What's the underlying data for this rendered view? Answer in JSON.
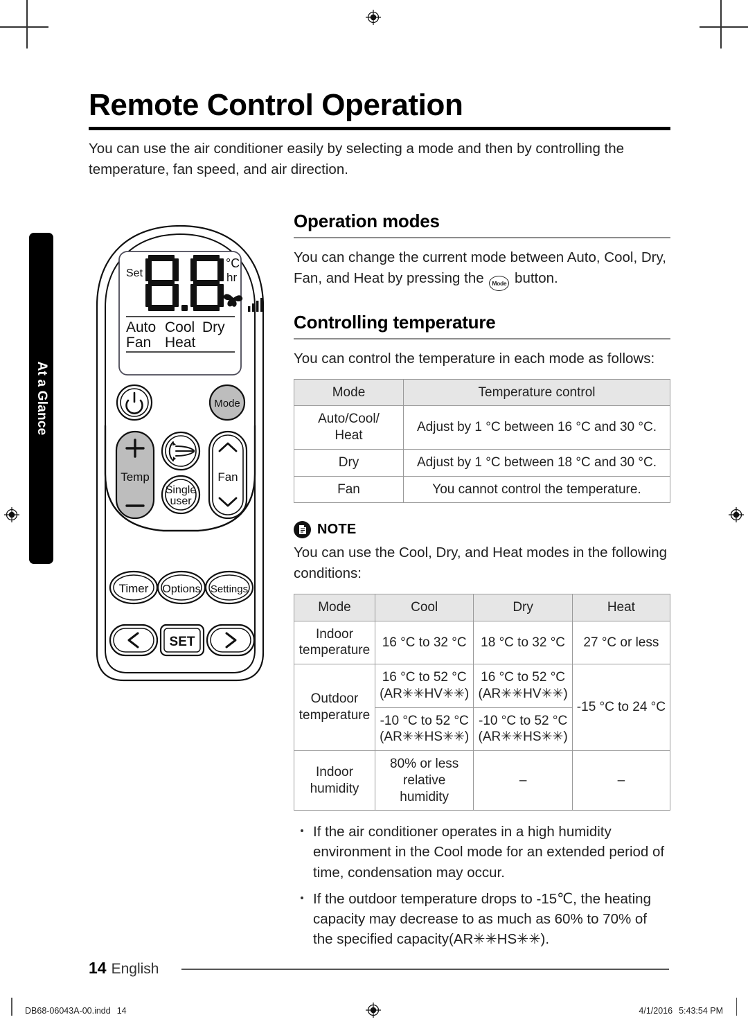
{
  "page": {
    "title": "Remote Control Operation",
    "intro": "You can use the air conditioner easily by selecting a mode and then by controlling the temperature, fan speed, and air direction.",
    "side_tab": "At a Glance",
    "page_number": "14",
    "language": "English"
  },
  "sections": {
    "operation_modes": {
      "heading": "Operation modes",
      "body_before": "You can change the current mode between Auto, Cool, Dry, Fan, and Heat by pressing the",
      "chip_label": "Mode",
      "body_after": "button."
    },
    "controlling_temperature": {
      "heading": "Controlling temperature",
      "body": "You can control the temperature in each mode as follows:"
    }
  },
  "table_temp_control": {
    "headers": [
      "Mode",
      "Temperature control"
    ],
    "rows": [
      {
        "mode": "Auto/Cool/\nHeat",
        "control": "Adjust by 1 °C between 16 °C and 30 °C."
      },
      {
        "mode": "Dry",
        "control": "Adjust by 1 °C between 18 °C and 30 °C."
      },
      {
        "mode": "Fan",
        "control": "You cannot control the temperature."
      }
    ]
  },
  "note": {
    "label": "NOTE",
    "icon": "document-icon",
    "body": "You can use the Cool, Dry, and Heat modes in the following conditions:"
  },
  "table_conditions": {
    "headers": [
      "Mode",
      "Cool",
      "Dry",
      "Heat"
    ],
    "indoor_temperature": {
      "label": "Indoor\ntemperature",
      "cool": "16 °C to 32 °C",
      "dry": "18 °C to 32 °C",
      "heat": "27 °C or less"
    },
    "outdoor_temperature": {
      "label": "Outdoor\ntemperature",
      "cool_hv": "16 °C to 52 °C\n(AR✳✳HV✳✳)",
      "dry_hv": "16 °C to 52 °C\n(AR✳✳HV✳✳)",
      "cool_hs": "-10 °C to 52 °C\n(AR✳✳HS✳✳)",
      "dry_hs": "-10 °C to 52 °C\n(AR✳✳HS✳✳)",
      "heat": "-15 °C to 24 °C"
    },
    "indoor_humidity": {
      "label": "Indoor\nhumidity",
      "cool": "80% or less\nrelative\nhumidity",
      "dry": "–",
      "heat": "–"
    }
  },
  "bullets": [
    "If the air conditioner operates in a high humidity environment in the Cool mode for an extended period of time, condensation may occur.",
    "If the outdoor temperature drops to -15℃, the heating capacity may decrease to as much as 60% to 70% of the specified capacity(AR✳✳HS✳✳)."
  ],
  "remote": {
    "display": {
      "set_label": "Set",
      "digits": "8.8",
      "unit_celsius": "°C",
      "unit_hour": "hr",
      "modes_line1": [
        "Auto",
        "Cool",
        "Dry"
      ],
      "modes_line2": [
        "Fan",
        "Heat"
      ]
    },
    "buttons": {
      "power": "power-icon",
      "mode": "Mode",
      "temp": "Temp",
      "temp_up": "+",
      "temp_down": "−",
      "airflow": "airflow-icon",
      "single_user_line1": "Single",
      "single_user_line2": "user",
      "fan": "Fan",
      "timer": "Timer",
      "options": "Options",
      "settings": "Settings",
      "set": "SET",
      "prev": "‹",
      "next": "›"
    }
  },
  "footer": {
    "file_name": "DB68-06043A-00.indd",
    "file_page": "14",
    "date": "4/1/2016",
    "time": "5:43:54 PM"
  }
}
